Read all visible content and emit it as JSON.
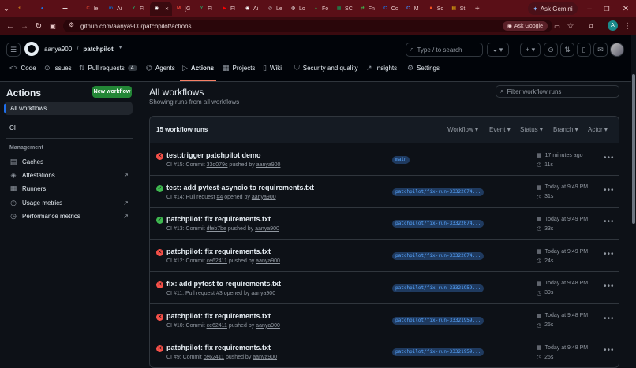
{
  "browser": {
    "tabs": [
      {
        "label": "",
        "icon": "ff-icon",
        "color": "#f6a623",
        "glyph": "⚡"
      },
      {
        "label": "",
        "icon": "app-icon",
        "color": "#1a73e8",
        "glyph": "●"
      },
      {
        "label": "",
        "icon": "app-icon",
        "color": "#ffffff",
        "glyph": "▬"
      },
      {
        "label": "le",
        "icon": "cc-icon",
        "color": "#c0392b",
        "glyph": "C"
      },
      {
        "label": "Ai",
        "icon": "linkedin-icon",
        "color": "#0a66c2",
        "glyph": "in"
      },
      {
        "label": "Fl",
        "icon": "y-icon",
        "color": "#2e8b57",
        "glyph": "Y"
      },
      {
        "label": "",
        "icon": "github-icon",
        "color": "#ffffff",
        "glyph": "◉",
        "active": true
      },
      {
        "label": "[G",
        "icon": "gmail-icon",
        "color": "#ea4335",
        "glyph": "M"
      },
      {
        "label": "Fl",
        "icon": "y-icon",
        "color": "#2e8b57",
        "glyph": "Y"
      },
      {
        "label": "Fl",
        "icon": "youtube-icon",
        "color": "#ff0000",
        "glyph": "▶"
      },
      {
        "label": "Ai",
        "icon": "github-icon",
        "color": "#ffffff",
        "glyph": "◉"
      },
      {
        "label": "Le",
        "icon": "globe-icon",
        "color": "#cccccc",
        "glyph": "◎"
      },
      {
        "label": "Lo",
        "icon": "site-icon",
        "color": "#ffffff",
        "glyph": "◍"
      },
      {
        "label": "Fo",
        "icon": "drive-icon",
        "color": "#34a853",
        "glyph": "▲"
      },
      {
        "label": "SC",
        "icon": "sheet-icon",
        "color": "#0f9d58",
        "glyph": "▦"
      },
      {
        "label": "Fn",
        "icon": "site-icon",
        "color": "#3fb950",
        "glyph": "⇄"
      },
      {
        "label": "Cc",
        "icon": "c-icon",
        "color": "#1a73e8",
        "glyph": "C"
      },
      {
        "label": "M",
        "icon": "c-icon",
        "color": "#4285f4",
        "glyph": "C"
      },
      {
        "label": "Sc",
        "icon": "ms-icon",
        "color": "#f25022",
        "glyph": "■"
      },
      {
        "label": "St",
        "icon": "note-icon",
        "color": "#f4c20d",
        "glyph": "▤"
      }
    ],
    "ask_gemini": "Ask Gemini",
    "url": "github.com/aanya900/patchpilot/actions",
    "ask_google": "Ask Google",
    "profile_letter": "A"
  },
  "header": {
    "owner": "aanya900",
    "sep": "/",
    "repo": "patchpilot",
    "search_placeholder": "Type / to search"
  },
  "repo_tabs": [
    {
      "label": "Code",
      "icon": "code-icon",
      "glyph": "<>"
    },
    {
      "label": "Issues",
      "icon": "issue-icon",
      "glyph": "⊙"
    },
    {
      "label": "Pull requests",
      "icon": "pr-icon",
      "glyph": "⇅",
      "count": "4"
    },
    {
      "label": "Agents",
      "icon": "agent-icon",
      "glyph": "⌬"
    },
    {
      "label": "Actions",
      "icon": "play-icon",
      "glyph": "▷"
    },
    {
      "label": "Projects",
      "icon": "table-icon",
      "glyph": "▦"
    },
    {
      "label": "Wiki",
      "icon": "book-icon",
      "glyph": "▯"
    },
    {
      "label": "Security and quality",
      "icon": "shield-icon",
      "glyph": "⛉"
    },
    {
      "label": "Insights",
      "icon": "graph-icon",
      "glyph": "↗"
    },
    {
      "label": "Settings",
      "icon": "gear-icon",
      "glyph": "⚙"
    }
  ],
  "sidebar": {
    "title": "Actions",
    "new_workflow": "New workflow",
    "all_workflows": "All workflows",
    "ci": "CI",
    "management": "Management",
    "items": [
      {
        "label": "Caches",
        "icon": "cache-icon",
        "glyph": "▤"
      },
      {
        "label": "Attestations",
        "icon": "attest-icon",
        "glyph": "◈",
        "ext": true
      },
      {
        "label": "Runners",
        "icon": "server-icon",
        "glyph": "▦"
      },
      {
        "label": "Usage metrics",
        "icon": "meter-icon",
        "glyph": "◷",
        "ext": true
      },
      {
        "label": "Performance metrics",
        "icon": "meter-icon",
        "glyph": "◷",
        "ext": true
      }
    ]
  },
  "main": {
    "title": "All workflows",
    "subtitle": "Showing runs from all workflows",
    "filter_placeholder": "Filter workflow runs",
    "count_label": "15 workflow runs",
    "filters": [
      "Workflow",
      "Event",
      "Status",
      "Branch",
      "Actor"
    ],
    "runs": [
      {
        "status": "fail",
        "title": "test:trigger patchpilot demo",
        "num": "CI #15:",
        "kind": "Commit",
        "ref": "33d079c",
        "verb": "pushed by",
        "user": "aanya900",
        "branch": "main",
        "when": "17 minutes ago",
        "dur": "11s"
      },
      {
        "status": "ok",
        "title": "test: add pytest-asyncio to requirements.txt",
        "num": "CI #14:",
        "kind": "Pull request",
        "ref": "#4",
        "verb": "opened by",
        "user": "aanya900",
        "branch": "patchpilot/fix-run-33322074...",
        "when": "Today at 9:49 PM",
        "dur": "31s"
      },
      {
        "status": "ok",
        "title": "patchpilot: fix requirements.txt",
        "num": "CI #13:",
        "kind": "Commit",
        "ref": "dfeb7be",
        "verb": "pushed by",
        "user": "aanya900",
        "branch": "patchpilot/fix-run-33322074...",
        "when": "Today at 9:49 PM",
        "dur": "33s"
      },
      {
        "status": "fail",
        "title": "patchpilot: fix requirements.txt",
        "num": "CI #12:",
        "kind": "Commit",
        "ref": "ce62411",
        "verb": "pushed by",
        "user": "aanya900",
        "branch": "patchpilot/fix-run-33322074...",
        "when": "Today at 9:49 PM",
        "dur": "24s"
      },
      {
        "status": "fail",
        "title": "fix: add pytest to requirements.txt",
        "num": "CI #11:",
        "kind": "Pull request",
        "ref": "#3",
        "verb": "opened by",
        "user": "aanya900",
        "branch": "patchpilot/fix-run-33321959...",
        "when": "Today at 9:48 PM",
        "dur": "39s"
      },
      {
        "status": "fail",
        "title": "patchpilot: fix requirements.txt",
        "num": "CI #10:",
        "kind": "Commit",
        "ref": "ce62411",
        "verb": "pushed by",
        "user": "aanya900",
        "branch": "patchpilot/fix-run-33321959...",
        "when": "Today at 9:48 PM",
        "dur": "25s"
      },
      {
        "status": "fail",
        "title": "patchpilot: fix requirements.txt",
        "num": "CI #9:",
        "kind": "Commit",
        "ref": "ce62411",
        "verb": "pushed by",
        "user": "aanya900",
        "branch": "patchpilot/fix-run-33321959...",
        "when": "Today at 9:48 PM",
        "dur": "25s"
      }
    ]
  },
  "colors": {
    "accent": "#f78166",
    "success": "#3fb950",
    "failure": "#f85149",
    "primary_button": "#238636"
  }
}
